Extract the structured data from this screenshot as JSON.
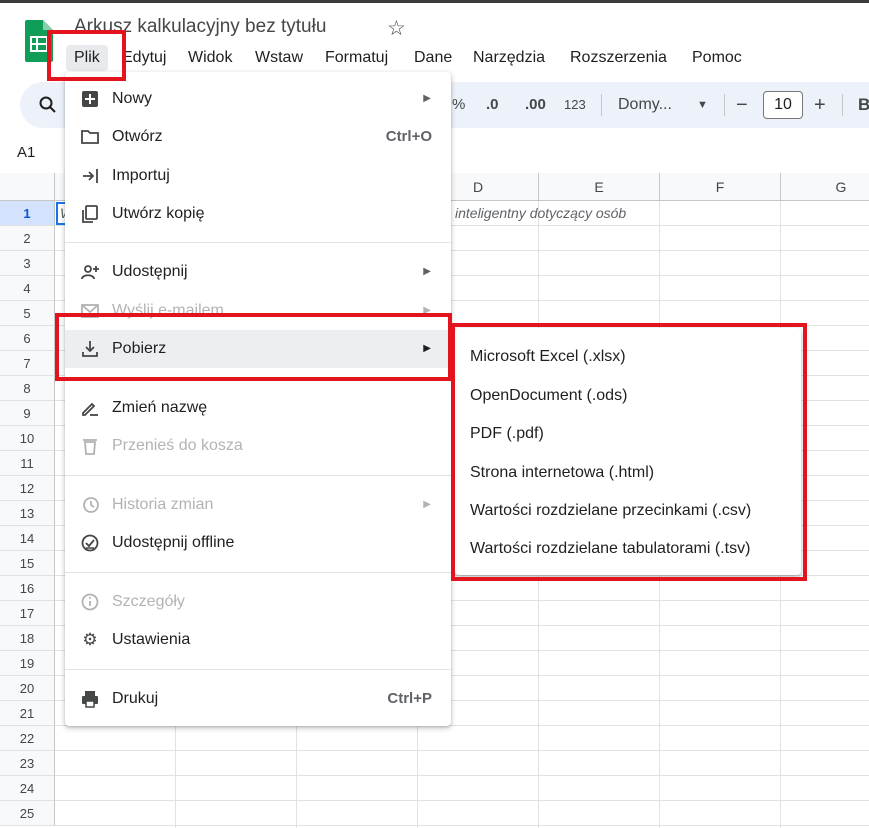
{
  "document_title": "Arkusz kalkulacyjny bez tytułu",
  "menubar": [
    "Plik",
    "Edytuj",
    "Widok",
    "Wstaw",
    "Formatuj",
    "Dane",
    "Narzędzia",
    "Rozszerzenia",
    "Pomoc"
  ],
  "toolbar": {
    "percent": "%",
    "decrease_decimal": ".0",
    "increase_decimal": ".00",
    "number_format": "123",
    "font_name": "Domy...",
    "font_size": "10",
    "minus": "−",
    "plus": "+",
    "bold": "B"
  },
  "name_box": "A1",
  "columns": [
    "D",
    "E",
    "F",
    "G"
  ],
  "rows": [
    "1",
    "2",
    "3",
    "4",
    "5",
    "6",
    "7",
    "8",
    "9",
    "10",
    "11",
    "12",
    "13",
    "14",
    "15",
    "16",
    "17",
    "18",
    "19",
    "20",
    "21",
    "22",
    "23",
    "24",
    "25"
  ],
  "cell_a1_partial": "W",
  "cell_visible_text": "inteligentny dotyczący osób",
  "file_menu": {
    "items": [
      {
        "label": "Nowy",
        "icon": "plus-box-icon",
        "submenu": true,
        "disabled": false
      },
      {
        "label": "Otwórz",
        "icon": "folder-icon",
        "shortcut": "Ctrl+O",
        "disabled": false
      },
      {
        "label": "Importuj",
        "icon": "import-icon",
        "disabled": false
      },
      {
        "label": "Utwórz kopię",
        "icon": "copy-icon",
        "disabled": false
      },
      {
        "label": "Udostępnij",
        "icon": "share-person-icon",
        "submenu": true,
        "disabled": false
      },
      {
        "label": "Wyślij e-mailem",
        "icon": "mail-icon",
        "submenu": true,
        "disabled": true
      },
      {
        "label": "Pobierz",
        "icon": "download-icon",
        "submenu": true,
        "disabled": false,
        "highlighted": true
      },
      {
        "label": "Zmień nazwę",
        "icon": "rename-icon",
        "disabled": false
      },
      {
        "label": "Przenieś do kosza",
        "icon": "trash-icon",
        "disabled": true
      },
      {
        "label": "Historia zmian",
        "icon": "history-icon",
        "submenu": true,
        "disabled": true
      },
      {
        "label": "Udostępnij offline",
        "icon": "offline-icon",
        "disabled": false
      },
      {
        "label": "Szczegóły",
        "icon": "info-icon",
        "disabled": true
      },
      {
        "label": "Ustawienia",
        "icon": "gear-icon",
        "disabled": false
      },
      {
        "label": "Drukuj",
        "icon": "printer-icon",
        "shortcut": "Ctrl+P",
        "disabled": false
      }
    ]
  },
  "download_submenu": [
    "Microsoft Excel (.xlsx)",
    "OpenDocument (.ods)",
    "PDF (.pdf)",
    "Strona internetowa (.html)",
    "Wartości rozdzielane przecinkami (.csv)",
    "Wartości rozdzielane tabulatorami (.tsv)"
  ],
  "colors": {
    "sheets_green": "#0f9d58",
    "annotation_red": "#e3141e",
    "toolbar_bg": "#edf2fa",
    "selection_blue": "#d3e3fd"
  }
}
